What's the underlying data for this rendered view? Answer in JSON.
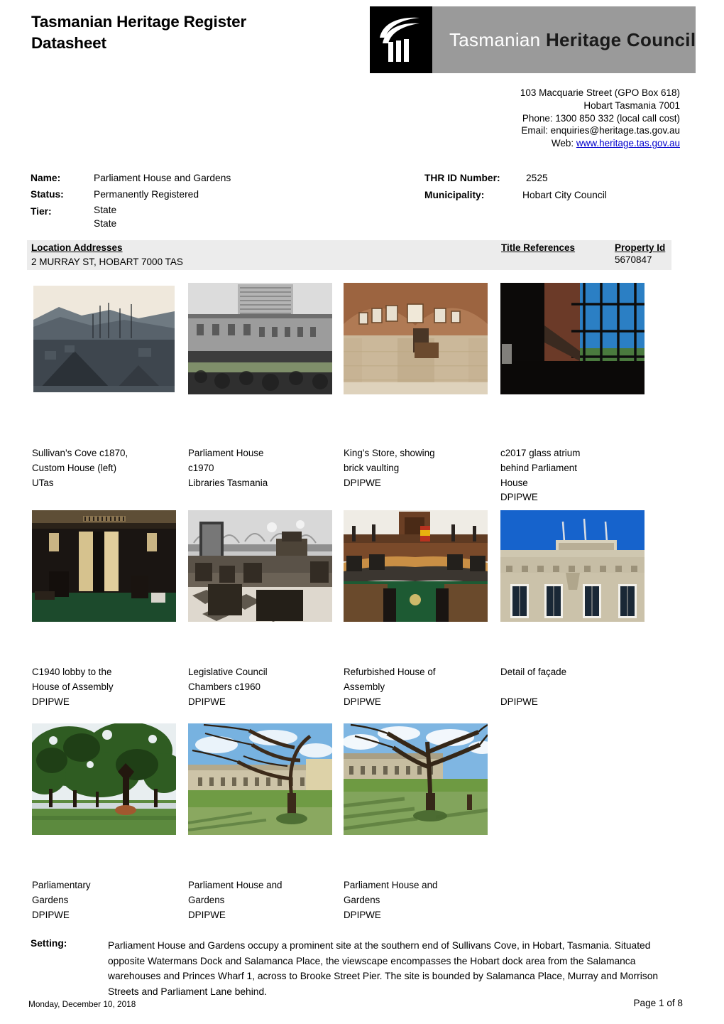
{
  "header": {
    "title": "Tasmanian Heritage Register\nDatasheet",
    "logo": {
      "icon": "column-pillar-icon",
      "word_light": "Tasmanian ",
      "word_bold": "Heritage Council"
    }
  },
  "contact": {
    "address_line1": "103 Macquarie Street (GPO Box 618)",
    "address_line2": "Hobart Tasmania  7001",
    "phone": "Phone: 1300 850 332 (local call cost)",
    "email": "Email:  enquiries@heritage.tas.gov.au",
    "web_label": "Web: ",
    "web_url": "www.heritage.tas.gov.au",
    "link_color": "#0000cc"
  },
  "record": {
    "name_label": "Name:",
    "name_value": "Parliament House and Gardens",
    "status_label": "Status:",
    "status_value": "Permanently Registered",
    "tier_label": "Tier:",
    "tier_value": "State\nState",
    "thr_id_label": "THR ID Number:",
    "thr_id_value": "2525",
    "municipality_label": "Municipality:",
    "municipality_value": "Hobart City Council"
  },
  "location_table": {
    "headers": {
      "addresses": "Location Addresses",
      "title_refs": "Title References",
      "property_id": "Property Id"
    },
    "row": {
      "address": "2 MURRAY ST, HOBART  7000  TAS",
      "title_ref": "",
      "property_id": "5670847"
    },
    "band_color": "#ececec"
  },
  "photo_rows": [
    {
      "cells": [
        {
          "alt": "sullivans-cove-historic-photo",
          "caption": "Sullivan’s Cove c1870,\nCustom House (left)\nUTas"
        },
        {
          "alt": "parliament-house-c1970-photo",
          "caption": "Parliament House\nc1970\nLibraries Tasmania"
        },
        {
          "alt": "kings-store-brick-vaulting-photo",
          "caption": "King’s Store, showing\nbrick vaulting\nDPIPWE"
        },
        {
          "alt": "glass-atrium-photo",
          "caption": "c2017 glass atrium\nbehind Parliament\nHouse\nDPIPWE"
        }
      ]
    },
    {
      "cells": [
        {
          "alt": "c1940-lobby-photo",
          "caption": "C1940 lobby to the\nHouse of Assembly\nDPIPWE"
        },
        {
          "alt": "legislative-council-chambers-photo",
          "caption": "Legislative Council\nChambers c1960\nDPIPWE"
        },
        {
          "alt": "refurbished-house-of-assembly-photo",
          "caption": "Refurbished House of\nAssembly\nDPIPWE"
        },
        {
          "alt": "facade-detail-photo",
          "caption": "Detail of façade\n\nDPIPWE"
        }
      ]
    },
    {
      "cells": [
        {
          "alt": "parliamentary-gardens-trees-photo",
          "caption": "Parliamentary\nGardens\nDPIPWE"
        },
        {
          "alt": "parliament-house-and-gardens-photo-1",
          "caption": "Parliament House and\nGardens\nDPIPWE"
        },
        {
          "alt": "parliament-house-and-gardens-photo-2",
          "caption": "Parliament House and\nGardens\nDPIPWE"
        }
      ]
    }
  ],
  "setting": {
    "label": "Setting:",
    "text": "Parliament House and Gardens occupy a prominent site at the southern end of Sullivans Cove, in Hobart, Tasmania. Situated opposite Watermans Dock and Salamanca Place, the viewscape encompasses the Hobart dock area from the Salamanca warehouses and Princes Wharf 1, across to Brooke Street Pier. The site is bounded by Salamanca Place, Murray and Morrison Streets and Parliament Lane behind."
  },
  "footer": {
    "date": "Monday, December 10, 2018",
    "page": "Page 1 of 8"
  }
}
